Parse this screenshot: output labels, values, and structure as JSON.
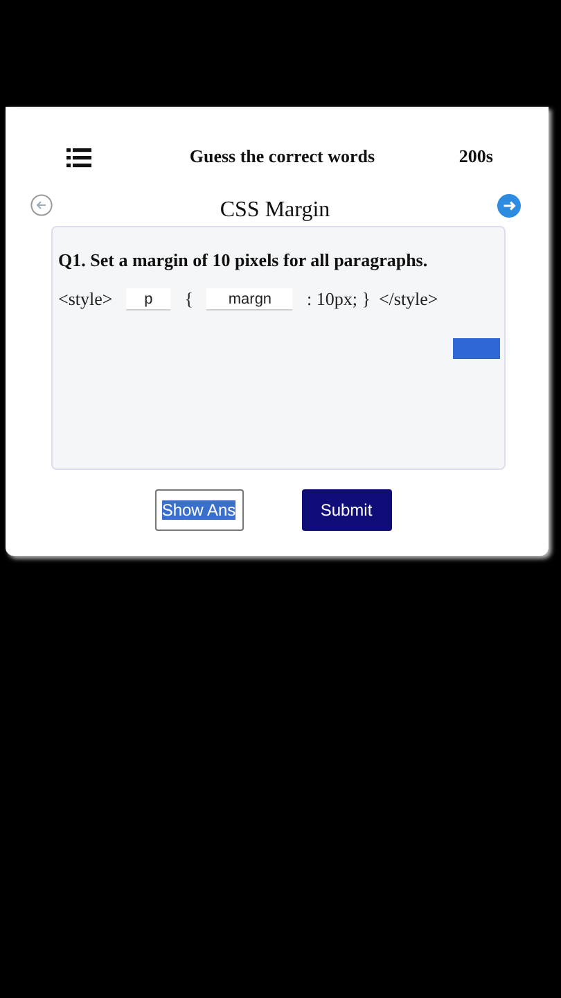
{
  "header": {
    "title": "Guess the correct words",
    "timer": "200s"
  },
  "lesson": {
    "title": "CSS Margin"
  },
  "question": {
    "text": "Q1. Set a margin of 10 pixels for all paragraphs.",
    "code": [
      {
        "kind": "text",
        "text": "<style>"
      },
      {
        "kind": "input",
        "value": "p"
      },
      {
        "kind": "text",
        "text": "{"
      },
      {
        "kind": "input",
        "value": "margn"
      },
      {
        "kind": "text",
        "text": ": 10px; }"
      },
      {
        "kind": "text",
        "text": "</style>"
      }
    ]
  },
  "buttons": [
    {
      "kind": "outline",
      "label": "Show Ans"
    },
    {
      "kind": "primary",
      "label": "Submit"
    }
  ]
}
